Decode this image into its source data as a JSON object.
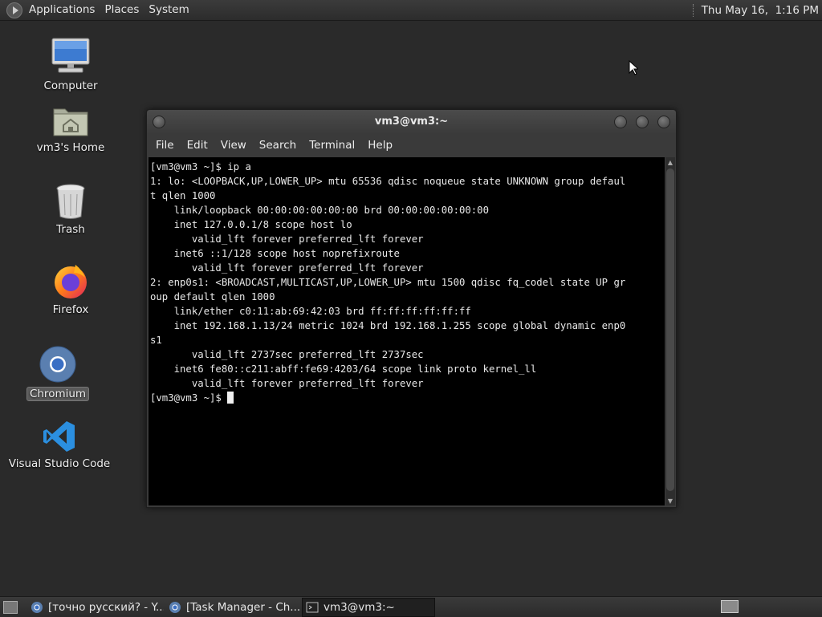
{
  "top_panel": {
    "menus": [
      "Applications",
      "Places",
      "System"
    ],
    "clock": "Thu May 16,  1:16 PM"
  },
  "desktop_icons": [
    {
      "label": "Computer",
      "icon": "computer-icon"
    },
    {
      "label": "vm3's Home",
      "icon": "home-folder-icon"
    },
    {
      "label": "Trash",
      "icon": "trash-icon"
    },
    {
      "label": "Firefox",
      "icon": "firefox-icon"
    },
    {
      "label": "Chromium",
      "icon": "chromium-icon",
      "selected": true
    },
    {
      "label": "Visual Studio Code",
      "icon": "vscode-icon"
    }
  ],
  "terminal": {
    "title": "vm3@vm3:~",
    "menu": [
      "File",
      "Edit",
      "View",
      "Search",
      "Terminal",
      "Help"
    ],
    "output": "[vm3@vm3 ~]$ ip a\n1: lo: <LOOPBACK,UP,LOWER_UP> mtu 65536 qdisc noqueue state UNKNOWN group defaul\nt qlen 1000\n    link/loopback 00:00:00:00:00:00 brd 00:00:00:00:00:00\n    inet 127.0.0.1/8 scope host lo\n       valid_lft forever preferred_lft forever\n    inet6 ::1/128 scope host noprefixroute\n       valid_lft forever preferred_lft forever\n2: enp0s1: <BROADCAST,MULTICAST,UP,LOWER_UP> mtu 1500 qdisc fq_codel state UP gr\noup default qlen 1000\n    link/ether c0:11:ab:69:42:03 brd ff:ff:ff:ff:ff:ff\n    inet 192.168.1.13/24 metric 1024 brd 192.168.1.255 scope global dynamic enp0\ns1\n       valid_lft 2737sec preferred_lft 2737sec\n    inet6 fe80::c211:abff:fe69:4203/64 scope link proto kernel_ll\n       valid_lft forever preferred_lft forever\n",
    "prompt": "[vm3@vm3 ~]$ "
  },
  "taskbar": {
    "tasks": [
      {
        "label": "[точно русский? - Y...",
        "icon": "chromium-icon"
      },
      {
        "label": "[Task Manager - Ch...",
        "icon": "chromium-icon"
      },
      {
        "label": "vm3@vm3:~",
        "icon": "terminal-icon",
        "active": true
      }
    ]
  },
  "colors": {
    "desktop_bg": "#2a2a2a",
    "terminal_bg": "#000000",
    "terminal_fg": "#e8e8e8",
    "vscode_blue": "#2b8fe0",
    "firefox_orange": "#ff7a1a"
  }
}
